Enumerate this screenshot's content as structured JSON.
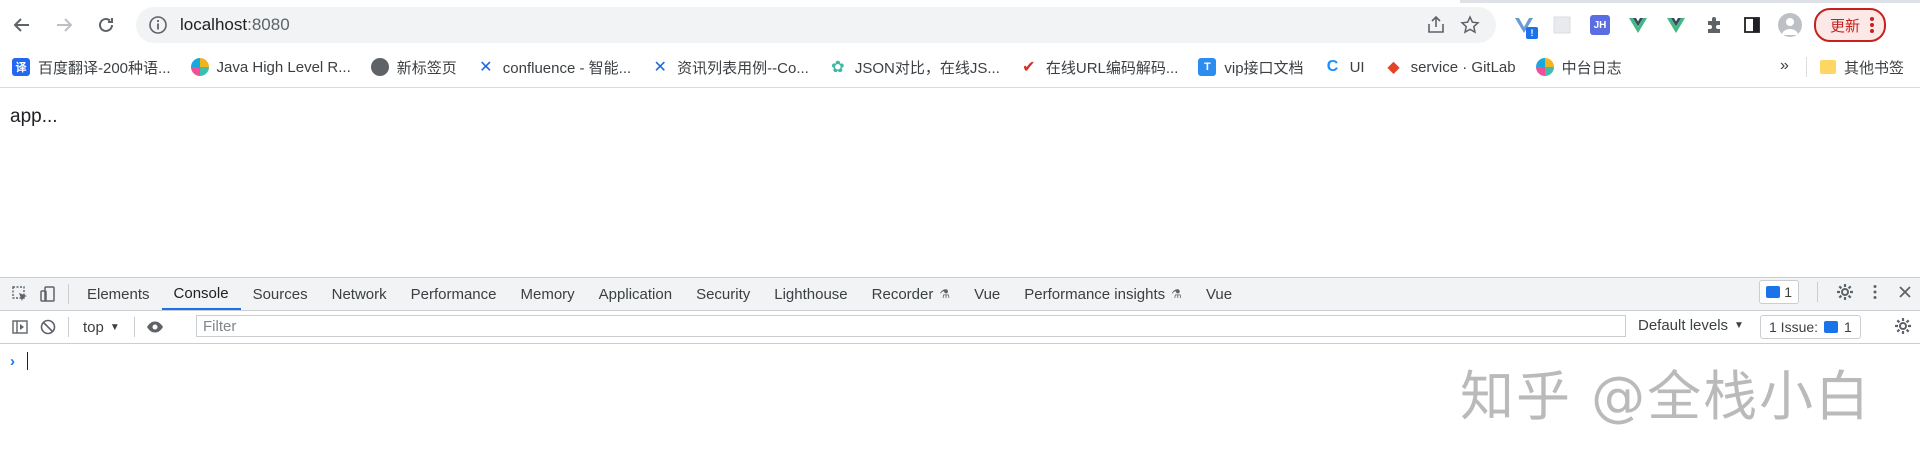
{
  "browser": {
    "url_host": "localhost",
    "url_port": ":8080",
    "update_label": "更新"
  },
  "extensions": {
    "jh_label": "JH",
    "badge_label": "!"
  },
  "bookmarks": [
    {
      "label": "百度翻译-200种语...",
      "icon": "baidu-translate-icon",
      "color": "#2468f2",
      "glyph": "译"
    },
    {
      "label": "Java High Level R...",
      "icon": "elastic-icon",
      "color": "#f0b41e",
      "glyph": ""
    },
    {
      "label": "新标签页",
      "icon": "circle-icon",
      "color": "#5f6368",
      "glyph": ""
    },
    {
      "label": "confluence - 智能...",
      "icon": "confluence-icon",
      "color": "#1868db",
      "glyph": "✕"
    },
    {
      "label": "资讯列表用例--Co...",
      "icon": "confluence-icon",
      "color": "#1868db",
      "glyph": "✕"
    },
    {
      "label": "JSON对比，在线JS...",
      "icon": "gear-flower-icon",
      "color": "#3cb9a6",
      "glyph": "✿"
    },
    {
      "label": "在线URL编码解码...",
      "icon": "checkmark-icon",
      "color": "#d93025",
      "glyph": "✔"
    },
    {
      "label": "vip接口文档",
      "icon": "t-doc-icon",
      "color": "#2d8cf0",
      "glyph": "T"
    },
    {
      "label": "UI",
      "icon": "ui-icon",
      "color": "#1890ff",
      "glyph": "C"
    },
    {
      "label": "service · GitLab",
      "icon": "gitlab-icon",
      "color": "#e24329",
      "glyph": "◆"
    },
    {
      "label": "中台日志",
      "icon": "elastic-icon",
      "color": "#f0b41e",
      "glyph": ""
    }
  ],
  "bookmarks_more": "»",
  "bookmarks_other": "其他书签",
  "page": {
    "text": "app..."
  },
  "devtools": {
    "tabs": [
      {
        "label": "Elements",
        "active": false,
        "experimental": false
      },
      {
        "label": "Console",
        "active": true,
        "experimental": false
      },
      {
        "label": "Sources",
        "active": false,
        "experimental": false
      },
      {
        "label": "Network",
        "active": false,
        "experimental": false
      },
      {
        "label": "Performance",
        "active": false,
        "experimental": false
      },
      {
        "label": "Memory",
        "active": false,
        "experimental": false
      },
      {
        "label": "Application",
        "active": false,
        "experimental": false
      },
      {
        "label": "Security",
        "active": false,
        "experimental": false
      },
      {
        "label": "Lighthouse",
        "active": false,
        "experimental": false
      },
      {
        "label": "Recorder",
        "active": false,
        "experimental": true
      },
      {
        "label": "Vue",
        "active": false,
        "experimental": false
      },
      {
        "label": "Performance insights",
        "active": false,
        "experimental": true
      },
      {
        "label": "Vue",
        "active": false,
        "experimental": false
      }
    ],
    "message_count": "1",
    "context": "top",
    "filter_placeholder": "Filter",
    "default_levels": "Default levels",
    "issues_label": "1 Issue:",
    "issues_count": "1",
    "prompt_symbol": "›"
  },
  "watermark": "知乎 @全栈小白"
}
